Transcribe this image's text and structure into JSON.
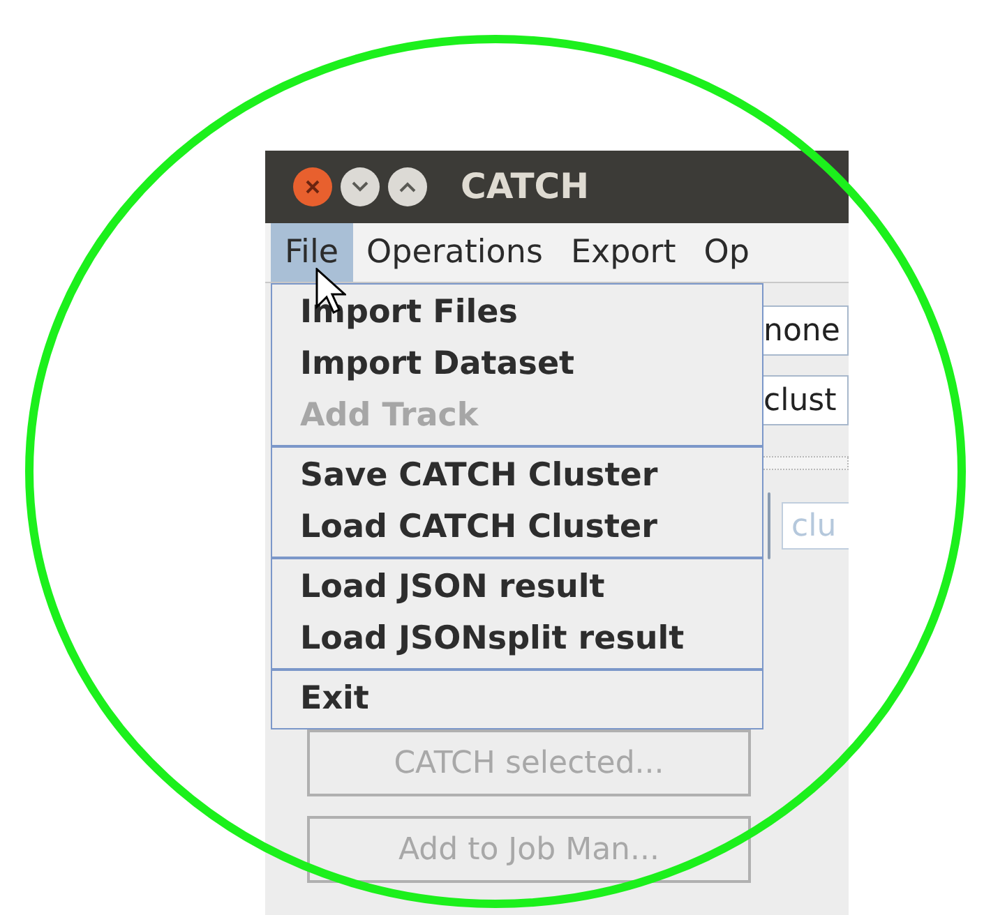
{
  "window": {
    "title": "CATCH"
  },
  "menu_bar": [
    {
      "label": "File",
      "selected": true
    },
    {
      "label": "Operations",
      "selected": false
    },
    {
      "label": "Export",
      "selected": false
    },
    {
      "label": "Op",
      "selected": false
    }
  ],
  "file_menu": [
    [
      {
        "label": "Import Files",
        "disabled": false
      },
      {
        "label": "Import Dataset",
        "disabled": false
      },
      {
        "label": "Add Track",
        "disabled": true
      }
    ],
    [
      {
        "label": "Save CATCH Cluster",
        "disabled": false
      },
      {
        "label": "Load CATCH Cluster",
        "disabled": false
      }
    ],
    [
      {
        "label": "Load JSON result",
        "disabled": false
      },
      {
        "label": "Load JSONsplit result",
        "disabled": false
      }
    ],
    [
      {
        "label": "Exit",
        "disabled": false
      }
    ]
  ],
  "fields": [
    "none",
    "clust"
  ],
  "search": {
    "placeholder": "clu"
  },
  "buttons": [
    {
      "label": "CATCH selected...",
      "disabled": true
    },
    {
      "label": "Add to Job Man...",
      "disabled": true
    }
  ]
}
